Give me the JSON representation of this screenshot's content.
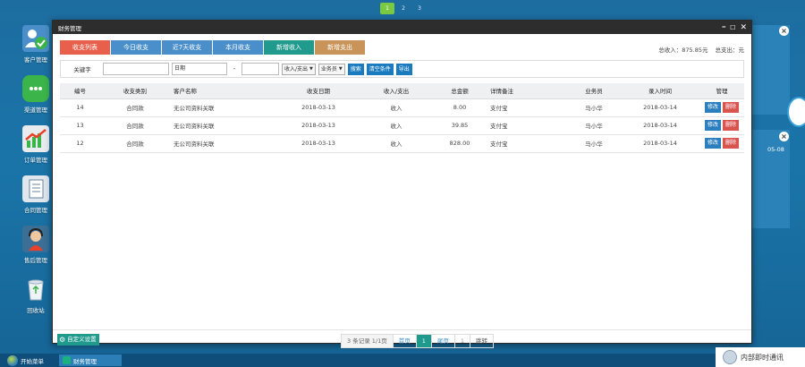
{
  "desktop_pager": [
    "1",
    "2",
    "3"
  ],
  "desktop_icons": [
    {
      "label": "客户管理"
    },
    {
      "label": "渠道管理"
    },
    {
      "label": "订单管理"
    },
    {
      "label": "合同管理"
    },
    {
      "label": "售后管理"
    },
    {
      "label": "回收站"
    }
  ],
  "bg_widget": {
    "date_text": "05-08"
  },
  "taskbar": {
    "start_label": "开始菜单",
    "task_label": "财务管理",
    "im_label": "内部即时通讯"
  },
  "window": {
    "title": "财务管理",
    "controls": {
      "minimize": "━",
      "maximize": "☐",
      "close": "✕"
    },
    "tabs": [
      {
        "label": "收支列表",
        "color": "#e8604c"
      },
      {
        "label": "今日收支",
        "color": "#4a8fc9"
      },
      {
        "label": "近7天收支",
        "color": "#4a8fc9"
      },
      {
        "label": "本月收支",
        "color": "#4a8fc9"
      },
      {
        "label": "新增收入",
        "color": "#1f9a8d"
      },
      {
        "label": "新增支出",
        "color": "#c9945a"
      }
    ],
    "totals": {
      "income": "总收入：875.85元",
      "expense": "总支出：元"
    },
    "filter": {
      "keyword_label": "关键字",
      "keyword_value": "",
      "date_label": "日期",
      "date_from": "",
      "date_sep": "-",
      "date_to": "",
      "type_select": "收入/支出",
      "staff_select": "业务员",
      "search_btn": "搜索",
      "clear_btn": "清空条件",
      "export_btn": "导出"
    },
    "table": {
      "headers": [
        "编号",
        "收支类别",
        "客户名称",
        "收支日期",
        "收入/支出",
        "总金额",
        "详情备注",
        "业务员",
        "录入时间",
        "管理"
      ],
      "rows": [
        {
          "id": "14",
          "category": "合同款",
          "customer": "无公司资料关联",
          "date": "2018-03-13",
          "type": "收入",
          "amount": "8.00",
          "note": "支付宝",
          "staff": "马小华",
          "entry": "2018-03-14"
        },
        {
          "id": "13",
          "category": "合同款",
          "customer": "无公司资料关联",
          "date": "2018-03-13",
          "type": "收入",
          "amount": "39.85",
          "note": "支付宝",
          "staff": "马小华",
          "entry": "2018-03-14"
        },
        {
          "id": "12",
          "category": "合同款",
          "customer": "无公司资料关联",
          "date": "2018-03-13",
          "type": "收入",
          "amount": "828.00",
          "note": "支付宝",
          "staff": "马小华",
          "entry": "2018-03-14"
        }
      ],
      "edit_label": "修改",
      "delete_label": "删除"
    },
    "footer": {
      "custom_btn": "自定义设置",
      "pager": {
        "info": "3 条记录 1/1页",
        "first": "首页",
        "current": "1",
        "last": "尾页",
        "goto_value": "1",
        "jump": "跳转"
      }
    }
  }
}
